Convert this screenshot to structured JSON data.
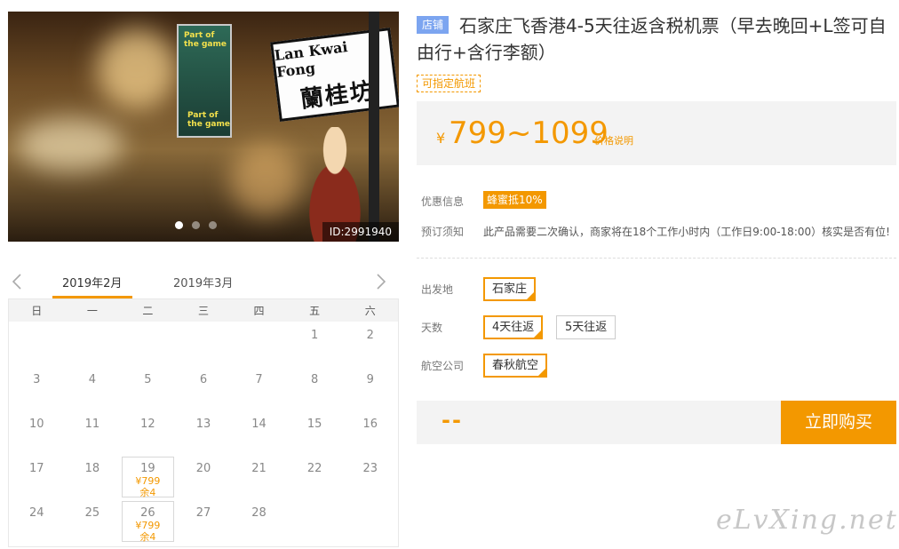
{
  "hero": {
    "sign_en": "Lan Kwai Fong",
    "sign_cn": "蘭桂坊",
    "poster_line1": "Part of",
    "poster_line2": "the game",
    "image_id": "ID:2991940"
  },
  "calendar": {
    "prev_icon": "chevron-left-icon",
    "next_icon": "chevron-right-icon",
    "months": [
      "2019年2月",
      "2019年3月"
    ],
    "active_month": "2019年2月",
    "weekdays": [
      "日",
      "一",
      "二",
      "三",
      "四",
      "五",
      "六"
    ],
    "days": [
      {
        "day": ""
      },
      {
        "day": ""
      },
      {
        "day": ""
      },
      {
        "day": ""
      },
      {
        "day": ""
      },
      {
        "day": "1"
      },
      {
        "day": "2"
      },
      {
        "day": "3"
      },
      {
        "day": "4"
      },
      {
        "day": "5"
      },
      {
        "day": "6"
      },
      {
        "day": "7"
      },
      {
        "day": "8"
      },
      {
        "day": "9"
      },
      {
        "day": "10"
      },
      {
        "day": "11"
      },
      {
        "day": "12"
      },
      {
        "day": "13"
      },
      {
        "day": "14"
      },
      {
        "day": "15"
      },
      {
        "day": "16"
      },
      {
        "day": "17"
      },
      {
        "day": "18"
      },
      {
        "day": "19",
        "price": "¥799",
        "stock": "余4"
      },
      {
        "day": "20"
      },
      {
        "day": "21"
      },
      {
        "day": "22"
      },
      {
        "day": "23"
      },
      {
        "day": "24"
      },
      {
        "day": "25"
      },
      {
        "day": "26",
        "price": "¥799",
        "stock": "余4"
      },
      {
        "day": "27"
      },
      {
        "day": "28"
      },
      {
        "day": ""
      },
      {
        "day": ""
      }
    ]
  },
  "product": {
    "shop_badge": "店铺",
    "title": "石家庄飞香港4-5天往返含税机票（早去晚回+L签可自由行+含行李额）",
    "flight_tag": "可指定航班",
    "price_symbol": "¥",
    "price_range": "799~1099",
    "price_note": "价格说明"
  },
  "info": {
    "promo_label": "优惠信息",
    "promo_badge": "蜂蜜抵10%",
    "notice_label": "预订须知",
    "notice_text": "此产品需要二次确认，商家将在18个工作小时内（工作日9:00-18:00）核实是否有位!"
  },
  "options": {
    "departure_label": "出发地",
    "departure": [
      {
        "label": "石家庄",
        "selected": true
      }
    ],
    "days_label": "天数",
    "days": [
      {
        "label": "4天往返",
        "selected": true
      },
      {
        "label": "5天往返",
        "selected": false
      }
    ],
    "airline_label": "航空公司",
    "airline": [
      {
        "label": "春秋航空",
        "selected": true
      }
    ]
  },
  "purchase": {
    "total_placeholder": "--",
    "buy_label": "立即购买"
  },
  "watermark": "eLvXing.net",
  "colors": {
    "accent": "#f39800",
    "shop_badge": "#7ca5f0"
  }
}
